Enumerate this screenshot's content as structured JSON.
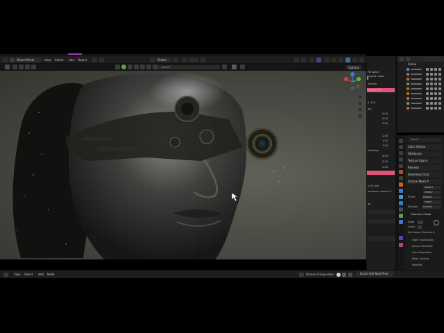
{
  "colors": {
    "accent_purple": "#a03bb5",
    "active_pink": "#e2557a",
    "header_bg": "#1e1e1e",
    "viewport_bg": "#4a4d45",
    "gizmo_red": "#e03b3b",
    "gizmo_green": "#55b84a",
    "gizmo_blue": "#3b7be0"
  },
  "header": {
    "mode": "Object Mode",
    "menus": [
      "View",
      "Select",
      "Add",
      "Object"
    ],
    "transform_space": "Global",
    "options_label": "Options"
  },
  "search": {
    "placeholder": "Search"
  },
  "node_panel": {
    "rows": [
      "Perspecti",
      "Layout Ladez",
      "Transfo",
      "s ved",
      "Texture Pla",
      "0.  112",
      "ion",
      "0.00",
      "0.00",
      "0.00",
      "1.00",
      "1.00",
      "1.00",
      "imitation",
      "0.99",
      "0.00",
      "0.00",
      "2.00 ved",
      "eminous value to 1",
      "gn"
    ]
  },
  "outliner": {
    "title": "Scene",
    "row_count": 9
  },
  "properties": {
    "search_placeholder": "Search",
    "panels": [
      "Color Attribu",
      "Attributes",
      "Texture Space",
      "Remesh",
      "Geometry Outs",
      "Octane Mesh P"
    ],
    "octane_fields": {
      "node_r": "Node R",
      "infinity": "Infinity",
      "priority_label": "Priorit",
      "priority_value": "Disable",
      "fake_label": "Fakeit",
      "window_label": "Window",
      "window_value": "Clockwi"
    },
    "geo_nodes_panel": "Geometric Node",
    "node_label": "Node",
    "octane_label": "Octan",
    "octane_geometric": "No Octane Geometric",
    "sub_panels": [
      "Open Subdivision",
      "Sphere Attribute",
      "Orbx Properties",
      "Mesh volume",
      "Meshlet"
    ],
    "animation": "Animation"
  },
  "status_bar": {
    "menus": [
      "View",
      "Select",
      "Add",
      "Node"
    ],
    "composition": "Octane Composition",
    "quick_add": "Quick Add NodeTree"
  },
  "icons": [
    "blender-logo-icon",
    "menu-icon",
    "cursor-icon",
    "move-icon",
    "rotate-icon",
    "scale-icon",
    "camera-icon",
    "hand-icon",
    "zoom-icon",
    "grid-icon",
    "filter-icon",
    "gear-icon",
    "search-icon",
    "eye-icon",
    "camera-render-icon"
  ]
}
